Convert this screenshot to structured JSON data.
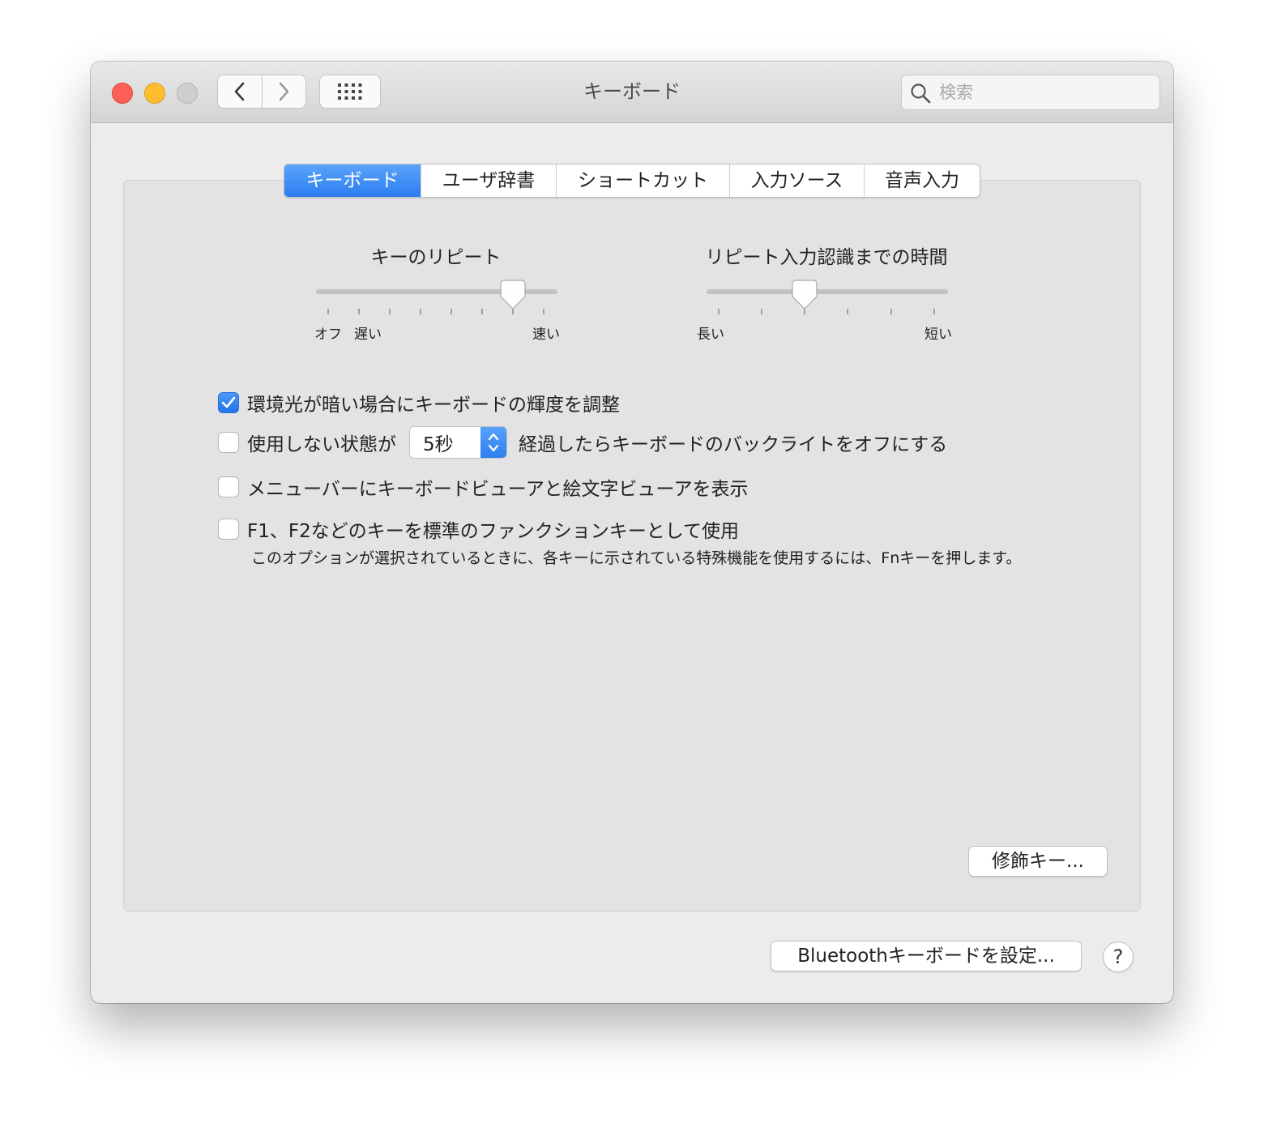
{
  "window": {
    "title": "キーボード"
  },
  "search": {
    "placeholder": "検索",
    "value": ""
  },
  "tabs": [
    {
      "label": "キーボード",
      "selected": true
    },
    {
      "label": "ユーザ辞書",
      "selected": false
    },
    {
      "label": "ショートカット",
      "selected": false
    },
    {
      "label": "入力ソース",
      "selected": false
    },
    {
      "label": "音声入力",
      "selected": false
    }
  ],
  "sliders": {
    "key_repeat": {
      "title": "キーのリピート",
      "labels": [
        "オフ",
        "遅い",
        "速い"
      ],
      "ticks": 8,
      "selected_index": 6
    },
    "delay_until_repeat": {
      "title": "リピート入力認識までの時間",
      "labels": [
        "長い",
        "短い"
      ],
      "ticks": 6,
      "selected_index": 2
    }
  },
  "options": {
    "backlight_adjust": {
      "label": "環境光が暗い場合にキーボードの輝度を調整",
      "checked": true
    },
    "backlight_off": {
      "label_before": "使用しない状態が",
      "stepper_value": "5秒",
      "label_after": "経過したらキーボードのバックライトをオフにする",
      "checked": false
    },
    "show_viewers": {
      "label": "メニューバーにキーボードビューアと絵文字ビューアを表示",
      "checked": false
    },
    "fn_keys": {
      "label": "F1、F2などのキーを標準のファンクションキーとして使用",
      "checked": false,
      "note": "このオプションが選択されているときに、各キーに示されている特殊機能を使用するには、Fnキーを押します。"
    }
  },
  "buttons": {
    "modifier_keys": "修飾キー...",
    "bluetooth": "Bluetoothキーボードを設定...",
    "help": "?"
  },
  "colors": {
    "accent": "#2f80f2",
    "close": "#fe5f57",
    "minimize": "#febc2e",
    "zoom_disabled": "#cfcfcf"
  },
  "icons": [
    "chevron-left-icon",
    "chevron-right-icon",
    "grid-icon",
    "search-icon",
    "checkmark-icon",
    "stepper-arrows-icon",
    "help-icon"
  ]
}
